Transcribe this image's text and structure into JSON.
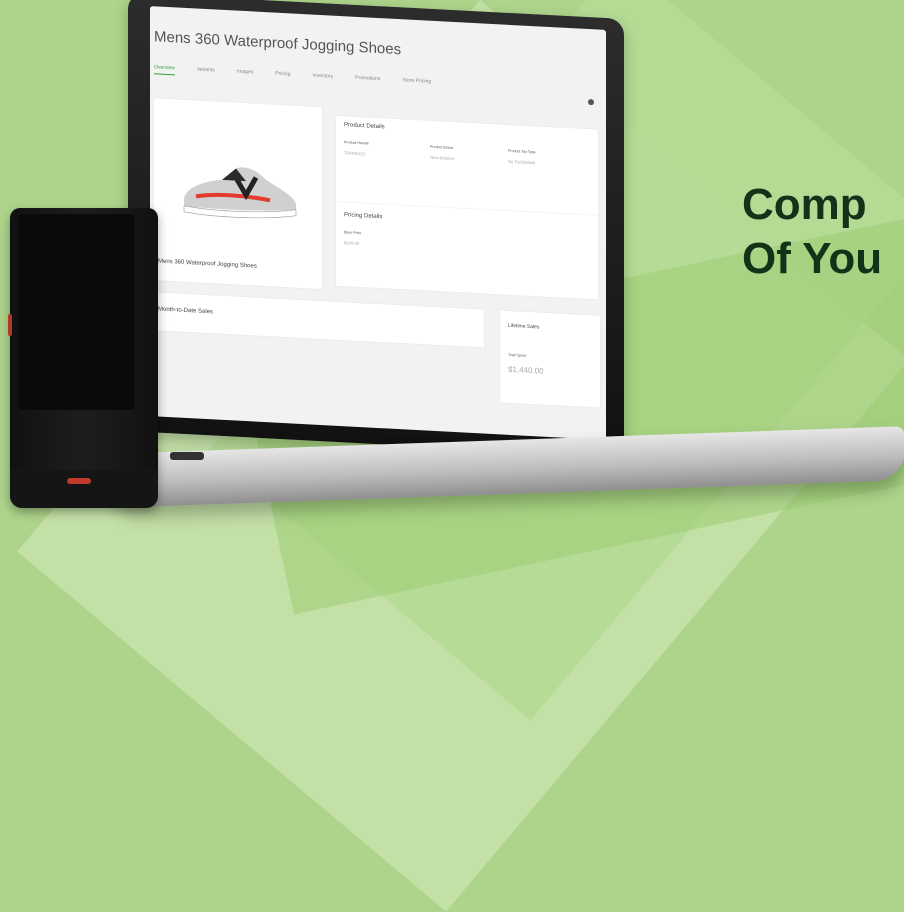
{
  "headline": {
    "line1": "Comp",
    "line2": "Of You"
  },
  "app": {
    "title": "Mens 360 Waterproof Jogging Shoes",
    "tabs": [
      "Overview",
      "Variants",
      "Images",
      "Pricing",
      "Inventory",
      "Promotions",
      "Store Pricing"
    ],
    "active_tab": "Overview",
    "product_image_label": "Mens 360 Waterproof Jogging Shoes",
    "product_details": {
      "title": "Product Details",
      "fields": [
        {
          "label": "Product Handle",
          "value": "789456123"
        },
        {
          "label": "Product Brand",
          "value": "New Balance"
        },
        {
          "label": "Product Tax Type",
          "value": "No Tax/Default"
        }
      ]
    },
    "pricing_details": {
      "title": "Pricing Details",
      "base_price_label": "Base Price",
      "base_price_value": "$240.00"
    },
    "month_to_date": {
      "title": "Month-to-Date Sales"
    },
    "lifetime": {
      "title": "Lifetime Sales",
      "total_label": "Total Spent",
      "total_value": "$1,440.00"
    }
  },
  "colors": {
    "background": "#aed48b",
    "headline": "#123317",
    "accent": "#3a9a3a",
    "phone_button": "#c0392b"
  }
}
